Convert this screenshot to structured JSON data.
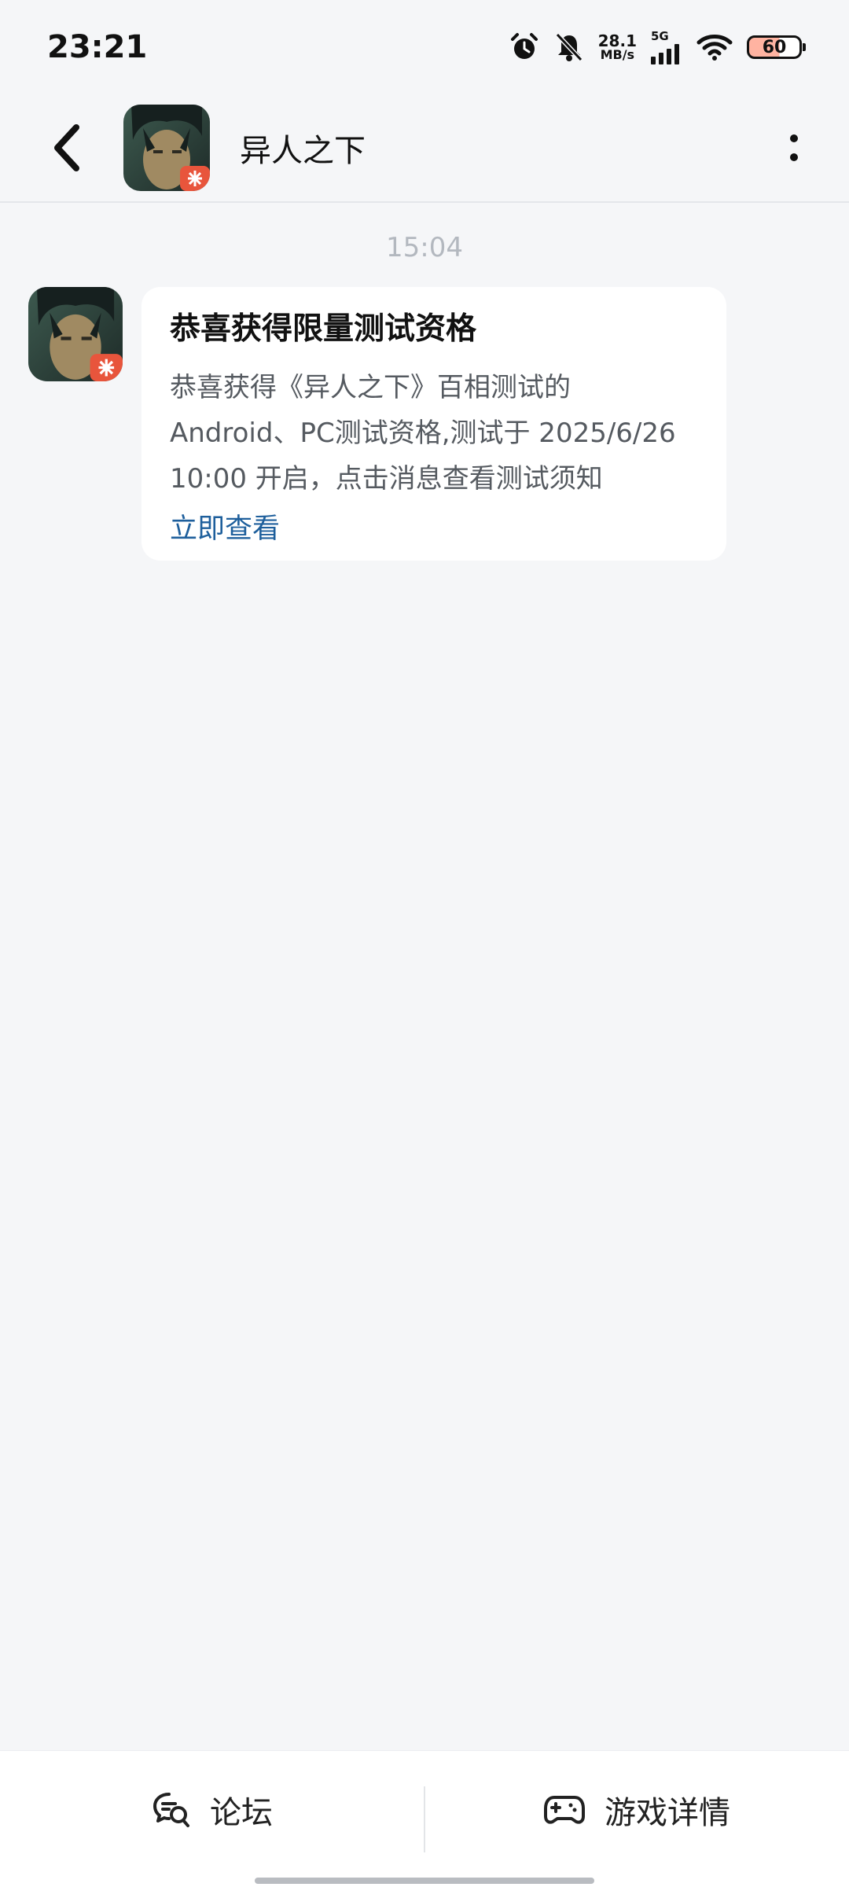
{
  "status_bar": {
    "time": "23:21",
    "net_speed_value": "28.1",
    "net_speed_unit": "MB/s",
    "network": "5G",
    "battery": "60",
    "icons": [
      "alarm-icon",
      "bell-muted-icon",
      "signal-icon",
      "wifi-icon",
      "battery-icon"
    ]
  },
  "header": {
    "title": "异人之下",
    "back_icon": "chevron-left-icon",
    "more_icon": "more-vertical-icon"
  },
  "chat": {
    "timestamp": "15:04",
    "message": {
      "title": "恭喜获得限量测试资格",
      "body": "恭喜获得《异人之下》百相测试的\nAndroid、PC测试资格,测试于 2025/6/26\n10:00 开启，点击消息查看测试须知",
      "link": "立即查看"
    }
  },
  "bottom_bar": {
    "forum_label": "论坛",
    "game_detail_label": "游戏详情"
  },
  "colors": {
    "background": "#f5f6f8",
    "link": "#1e5f9c",
    "timestamp": "#b3b8bf"
  }
}
